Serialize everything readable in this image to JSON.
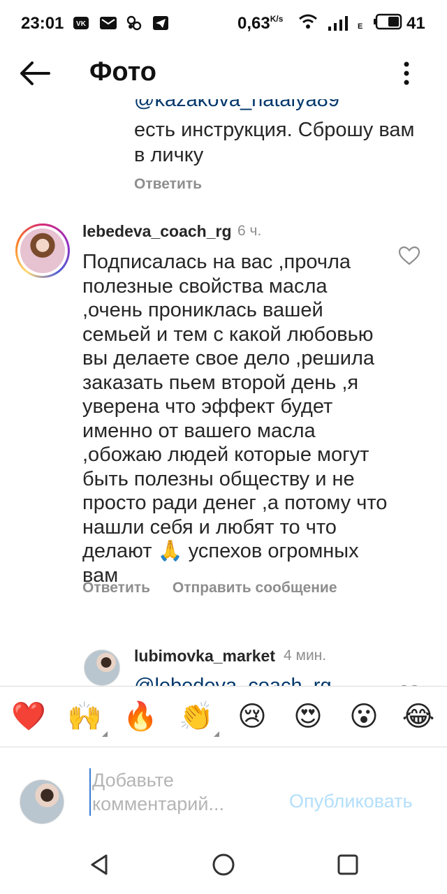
{
  "status_bar": {
    "time": "23:01",
    "speed": "0,63",
    "speed_unit": "K/s",
    "net_label": "E",
    "battery": "41"
  },
  "app_bar": {
    "title": "Фото",
    "back_icon": "arrow-left-icon",
    "more_icon": "more-vertical-icon"
  },
  "previous_reply": {
    "mention_cut": "@kazakova_natalya89",
    "text": "есть инструкция. Сброшу вам в личку",
    "reply_label": "Ответить"
  },
  "comment": {
    "username": "lebedeva_coach_rg",
    "time": "6 ч.",
    "text": "Подписалась на вас ,прочла полезные свойства масла ,очень прониклась вашей семьей и тем с какой любовью вы делаете свое дело ,решила заказать пьем второй день ,я уверена что эффект будет именно от вашего масла ,обожаю людей которые могут быть полезны обществу и не просто ради денег ,а потому что нашли себя и любят то что делают 🙏 успехов огромных вам",
    "reply_label": "Ответить",
    "message_label": "Отправить сообщение"
  },
  "reply": {
    "username": "lubimovka_market",
    "time": "4 мин.",
    "mention": "@lebedeva_coach_rg"
  },
  "emoji_bar": [
    "❤️",
    "🙌",
    "🔥",
    "👏",
    "😢",
    "😍",
    "😮",
    "😂"
  ],
  "composer": {
    "placeholder": "Добавьте комментарий...",
    "publish_label": "Опубликовать"
  },
  "colors": {
    "link": "#00376b",
    "muted": "#8e8e8e",
    "publish_disabled": "#b2dffc"
  }
}
